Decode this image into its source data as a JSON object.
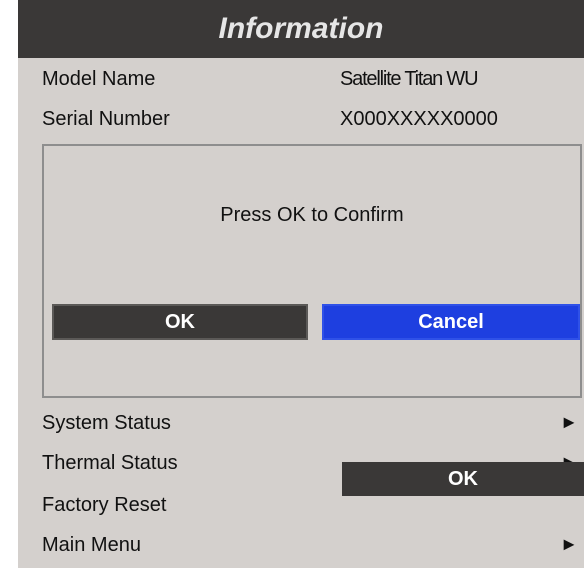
{
  "header": {
    "title": "Information"
  },
  "info": {
    "model_label": "Model Name",
    "model_value": "Satellite Titan WU",
    "serial_label": "Serial Number",
    "serial_value": "X000XXXXX0000"
  },
  "dialog": {
    "message": "Press OK to Confirm",
    "ok_label": "OK",
    "cancel_label": "Cancel"
  },
  "menu": {
    "system_status": "System Status",
    "thermal_status": "Thermal Status",
    "factory_reset": "Factory Reset",
    "factory_reset_button": "OK",
    "main_menu": "Main Menu",
    "arrow_glyph": "►"
  },
  "colors": {
    "titlebar": "#3a3837",
    "panel": "#d4d0cd",
    "accent": "#1e3fe0"
  }
}
